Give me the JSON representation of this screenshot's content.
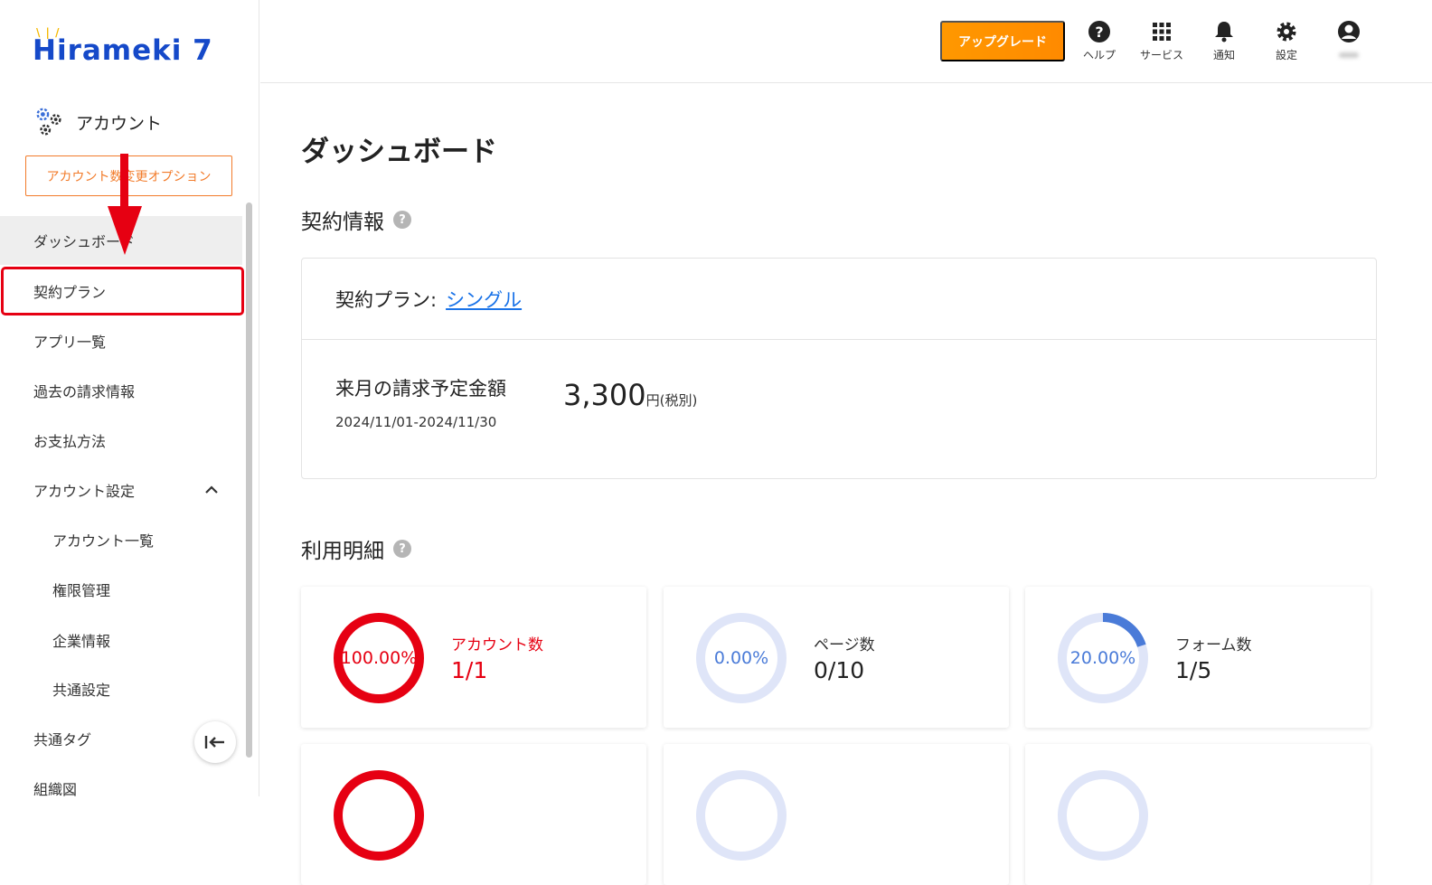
{
  "brand": {
    "logo_text": "Hirameki 7"
  },
  "sidebar": {
    "section_title": "アカウント",
    "option_button": "アカウント数変更オプション",
    "items": [
      {
        "label": "ダッシュボード"
      },
      {
        "label": "契約プラン"
      },
      {
        "label": "アプリ一覧"
      },
      {
        "label": "過去の請求情報"
      },
      {
        "label": "お支払方法"
      },
      {
        "label": "アカウント設定"
      },
      {
        "label": "アカウント一覧"
      },
      {
        "label": "権限管理"
      },
      {
        "label": "企業情報"
      },
      {
        "label": "共通設定"
      },
      {
        "label": "共通タグ"
      },
      {
        "label": "組織図"
      }
    ]
  },
  "topbar": {
    "upgrade_label": "アップグレード",
    "help_label": "ヘルプ",
    "service_label": "サービス",
    "notify_label": "通知",
    "settings_label": "設定"
  },
  "main": {
    "page_title": "ダッシュボード",
    "contract_section": "契約情報",
    "plan_label": "契約プラン:",
    "plan_value": "シングル",
    "billing_label": "来月の請求予定金額",
    "billing_period": "2024/11/01-2024/11/30",
    "billing_amount": "3,300",
    "billing_unit": "円(税別)",
    "usage_section": "利用明細",
    "usage": [
      {
        "label": "アカウント数",
        "value": "1/1",
        "percent": "100.00%",
        "ratio": 1.0,
        "status": "full"
      },
      {
        "label": "ページ数",
        "value": "0/10",
        "percent": "0.00%",
        "ratio": 0.0,
        "status": "normal"
      },
      {
        "label": "フォーム数",
        "value": "1/5",
        "percent": "20.00%",
        "ratio": 0.2,
        "status": "normal"
      }
    ]
  },
  "colors": {
    "brand_blue": "#1549c9",
    "accent_orange": "#ff8a00",
    "alert_red": "#e60012",
    "link_blue": "#1a73e8",
    "donut_track": "#dfe5f8",
    "donut_fill": "#4a7bd8"
  },
  "icons": [
    "gear-icon",
    "question-icon",
    "grid-icon",
    "bell-icon",
    "settings-gear-icon",
    "user-icon",
    "chevron-up-icon",
    "collapse-left-icon",
    "help-circle-icon"
  ]
}
